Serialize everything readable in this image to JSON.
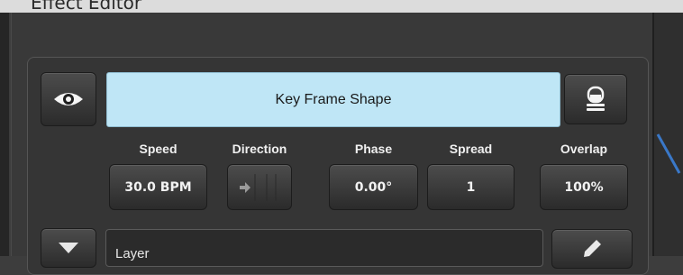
{
  "window": {
    "title": "Effect Editor"
  },
  "effect": {
    "shape_name": "Key Frame Shape"
  },
  "params": {
    "speed": {
      "label": "Speed",
      "value": "30.0 BPM"
    },
    "direction": {
      "label": "Direction",
      "icon": "arrow-right-icon"
    },
    "phase": {
      "label": "Phase",
      "value": "0.00°"
    },
    "spread": {
      "label": "Spread",
      "value": "1"
    },
    "overlap": {
      "label": "Overlap",
      "value": "100%"
    }
  },
  "layer": {
    "value": "Layer"
  },
  "icons": {
    "visibility": "eye-icon",
    "fixture": "fixture-icon",
    "expand": "triangle-down-icon",
    "edit": "pencil-icon"
  },
  "colors": {
    "shape_bg": "#bfe6f6",
    "panel_bg": "#353535",
    "accent_line": "#3a78c8",
    "text": "#f2f2f2"
  }
}
